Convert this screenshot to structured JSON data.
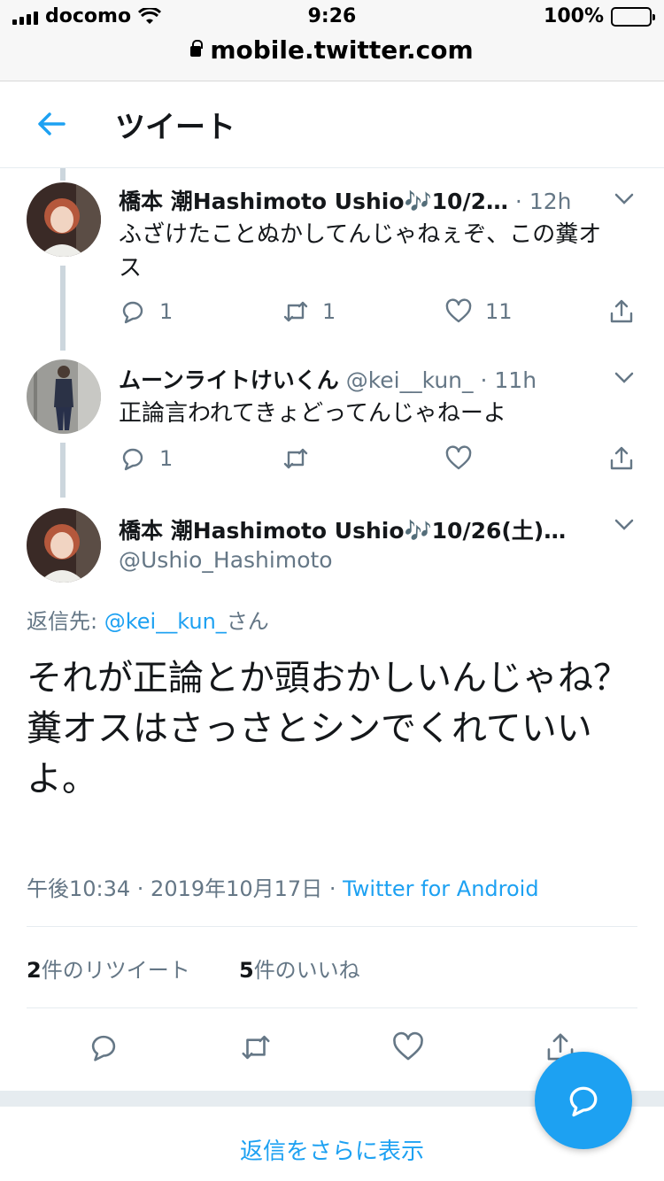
{
  "status_bar": {
    "carrier": "docomo",
    "time": "9:26",
    "battery": "100%"
  },
  "browser": {
    "url": "mobile.twitter.com"
  },
  "header": {
    "title": "ツイート"
  },
  "tweets": [
    {
      "name": "橋本 潮Hashimoto Ushio🎶10/2…",
      "time": "12h",
      "text": "ふざけたことぬかしてんじゃねぇぞ、この糞オス",
      "reply_count": "1",
      "retweet_count": "1",
      "like_count": "11"
    },
    {
      "name": "ムーンライトけいくん",
      "handle": "@kei__kun_",
      "time": "11h",
      "text": "正論言われてきょどってんじゃねーよ",
      "reply_count": "1",
      "retweet_count": "",
      "like_count": ""
    }
  ],
  "focused": {
    "name": "橋本 潮Hashimoto Ushio🎶10/26(土)…",
    "handle": "@Ushio_Hashimoto",
    "reply_label": "返信先: ",
    "reply_to": "@kei__kun_",
    "reply_suffix": "さん",
    "text": "それが正論とか頭おかしいんじゃね？\n糞オスはさっさとシンでくれていいよ。",
    "timestamp": "午後10:34 · 2019年10月17日 · ",
    "client": "Twitter for Android",
    "retweets": "2",
    "retweets_label": "件のリツイート",
    "likes": "5",
    "likes_label": "件のいいね"
  },
  "more_replies": "返信をさらに表示",
  "colors": {
    "accent": "#1da1f2",
    "muted": "#657786",
    "text": "#14171a"
  },
  "icons": [
    "back-arrow-icon",
    "reply-icon",
    "retweet-icon",
    "like-icon",
    "share-icon",
    "chevron-down-icon",
    "compose-reply-icon"
  ]
}
